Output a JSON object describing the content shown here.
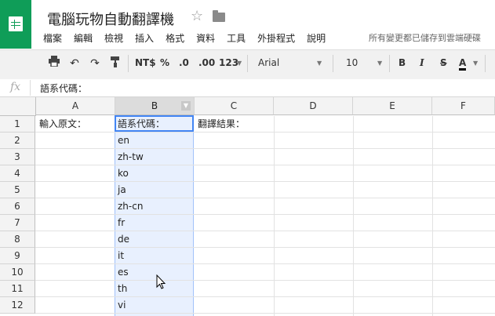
{
  "title": "電腦玩物自動翻譯機",
  "menu": [
    "檔案",
    "編輯",
    "檢視",
    "插入",
    "格式",
    "資料",
    "工具",
    "外掛程式",
    "說明"
  ],
  "save_status": "所有變更都已儲存到雲端硬碟",
  "toolbar": {
    "currency": "NT$",
    "percent": "%",
    "decimal_decrease": ".0",
    "decimal_increase": ".00",
    "number_format": "123",
    "font": "Arial",
    "font_size": "10",
    "bold": "B",
    "italic": "I",
    "strike": "S",
    "text_color": "A"
  },
  "formula_bar": {
    "fx": "fx",
    "content": "語系代碼："
  },
  "columns": [
    "A",
    "B",
    "C",
    "D",
    "E",
    "F"
  ],
  "rows": [
    "1",
    "2",
    "3",
    "4",
    "5",
    "6",
    "7",
    "8",
    "9",
    "10",
    "11",
    "12"
  ],
  "cells": {
    "A1": "輸入原文：",
    "B1": "語系代碼：",
    "C1": "翻譯結果：",
    "B": [
      "en",
      "zh-tw",
      "ko",
      "ja",
      "zh-cn",
      "fr",
      "de",
      "it",
      "es",
      "th",
      "vi"
    ]
  },
  "colors": {
    "brand": "#0f9d58",
    "selection": "#4285f4"
  }
}
